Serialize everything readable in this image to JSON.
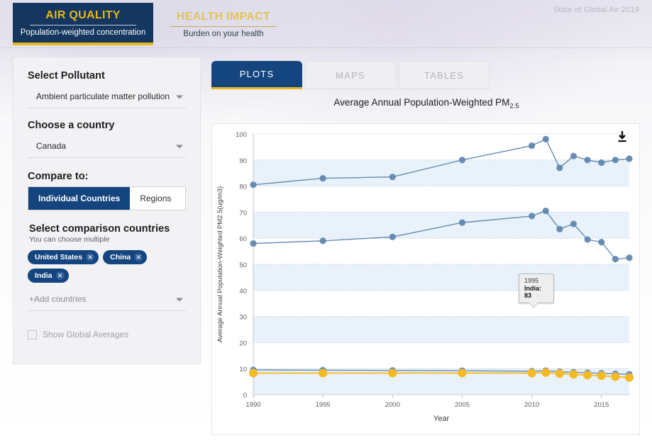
{
  "header": {
    "brand": "State of Global Air 2019",
    "modes": [
      {
        "title": "AIR QUALITY",
        "subtitle": "Population-weighted concentration",
        "active": true
      },
      {
        "title": "HEALTH IMPACT",
        "subtitle": "Burden on your health",
        "active": false
      }
    ]
  },
  "sidebar": {
    "pollutant_label": "Select Pollutant",
    "pollutant_value": "Ambient particulate matter pollution",
    "country_label": "Choose a country",
    "country_value": "Canada",
    "compare_label": "Compare to:",
    "compare_options": [
      {
        "label": "Individual Countries",
        "selected": true
      },
      {
        "label": "Regions",
        "selected": false
      }
    ],
    "comparison_heading": "Select comparison countries",
    "comparison_note": "You can choose multiple",
    "comparison_countries": [
      "United States",
      "China",
      "India"
    ],
    "add_countries_placeholder": "+Add countries",
    "global_averages_label": "Show Global Averages",
    "global_averages_checked": false
  },
  "main": {
    "tabs": [
      {
        "label": "PLOTS",
        "active": true
      },
      {
        "label": "MAPS",
        "active": false
      },
      {
        "label": "TABLES",
        "active": false
      }
    ],
    "download_icon": "download-icon"
  },
  "tooltip": {
    "year": "1995",
    "text": "India: 83"
  },
  "colors": {
    "navy": "#14457e",
    "gold": "#e8b71d",
    "series_blue": "#5e86ae",
    "series_yellow": "#f5b921",
    "band": "#dbeaf8"
  },
  "chart_data": {
    "type": "line",
    "title": "Average Annual Population-Weighted PM2.5",
    "xlabel": "Year",
    "ylabel": "Average Annual Population-Weighted PM2.5(ug/m3)",
    "xlim": [
      1990,
      2017
    ],
    "ylim": [
      0,
      100
    ],
    "yticks": [
      0,
      10,
      20,
      30,
      40,
      50,
      60,
      70,
      80,
      90,
      100
    ],
    "xticks": [
      1990,
      1995,
      2000,
      2005,
      2010,
      2015
    ],
    "grid": "horizontal-dotted-with-alternating-bands",
    "legend": "none",
    "x": [
      1990,
      1995,
      2000,
      2005,
      2010,
      2011,
      2012,
      2013,
      2014,
      2015,
      2016,
      2017
    ],
    "series": [
      {
        "name": "India",
        "color": "#5e86ae",
        "x": [
          1990,
          1995,
          2000,
          2005,
          2010,
          2011,
          2012,
          2013,
          2014,
          2015,
          2016,
          2017
        ],
        "values": [
          80.5,
          83,
          83.5,
          90,
          95.5,
          98,
          87,
          91.5,
          90,
          89,
          90,
          90.5
        ]
      },
      {
        "name": "China",
        "color": "#5e86ae",
        "x": [
          1990,
          1995,
          2000,
          2005,
          2010,
          2011,
          2012,
          2013,
          2014,
          2015,
          2016,
          2017
        ],
        "values": [
          58,
          59,
          60.5,
          66,
          68.5,
          70.5,
          63.5,
          65.5,
          59.5,
          58.5,
          52,
          52.5
        ]
      },
      {
        "name": "Canada",
        "color": "#5e86ae",
        "x": [
          1990,
          1995,
          2000,
          2005,
          2010,
          2011,
          2012,
          2013,
          2014,
          2015,
          2016,
          2017
        ],
        "values": [
          9.5,
          9.4,
          9.3,
          9.2,
          9.0,
          9.2,
          8.8,
          8.6,
          8.4,
          8.2,
          8.0,
          7.8
        ]
      },
      {
        "name": "United States",
        "color": "#f5b921",
        "x": [
          1990,
          1995,
          2000,
          2005,
          2010,
          2011,
          2012,
          2013,
          2014,
          2015,
          2016,
          2017
        ],
        "values": [
          8.3,
          8.3,
          8.3,
          8.3,
          8.3,
          8.5,
          8.1,
          7.8,
          7.5,
          7.3,
          6.9,
          6.6
        ]
      }
    ]
  }
}
